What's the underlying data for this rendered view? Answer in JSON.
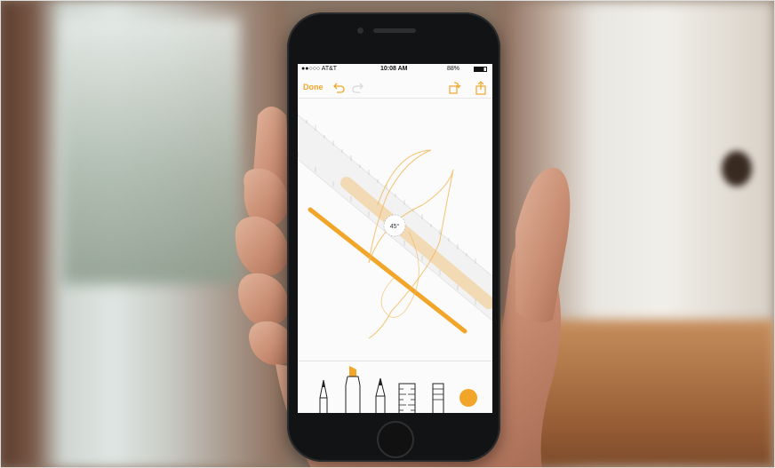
{
  "status_bar": {
    "carrier": "●●○○○ AT&T",
    "time": "10:08 AM",
    "battery": "88%"
  },
  "nav": {
    "done_label": "Done"
  },
  "ruler": {
    "angle_label": "45°"
  },
  "tools": [
    "pen-icon",
    "marker-icon",
    "pencil-icon",
    "ruler-icon",
    "eraser-icon",
    "color-picker-icon"
  ],
  "accent_color": "#f5a623"
}
